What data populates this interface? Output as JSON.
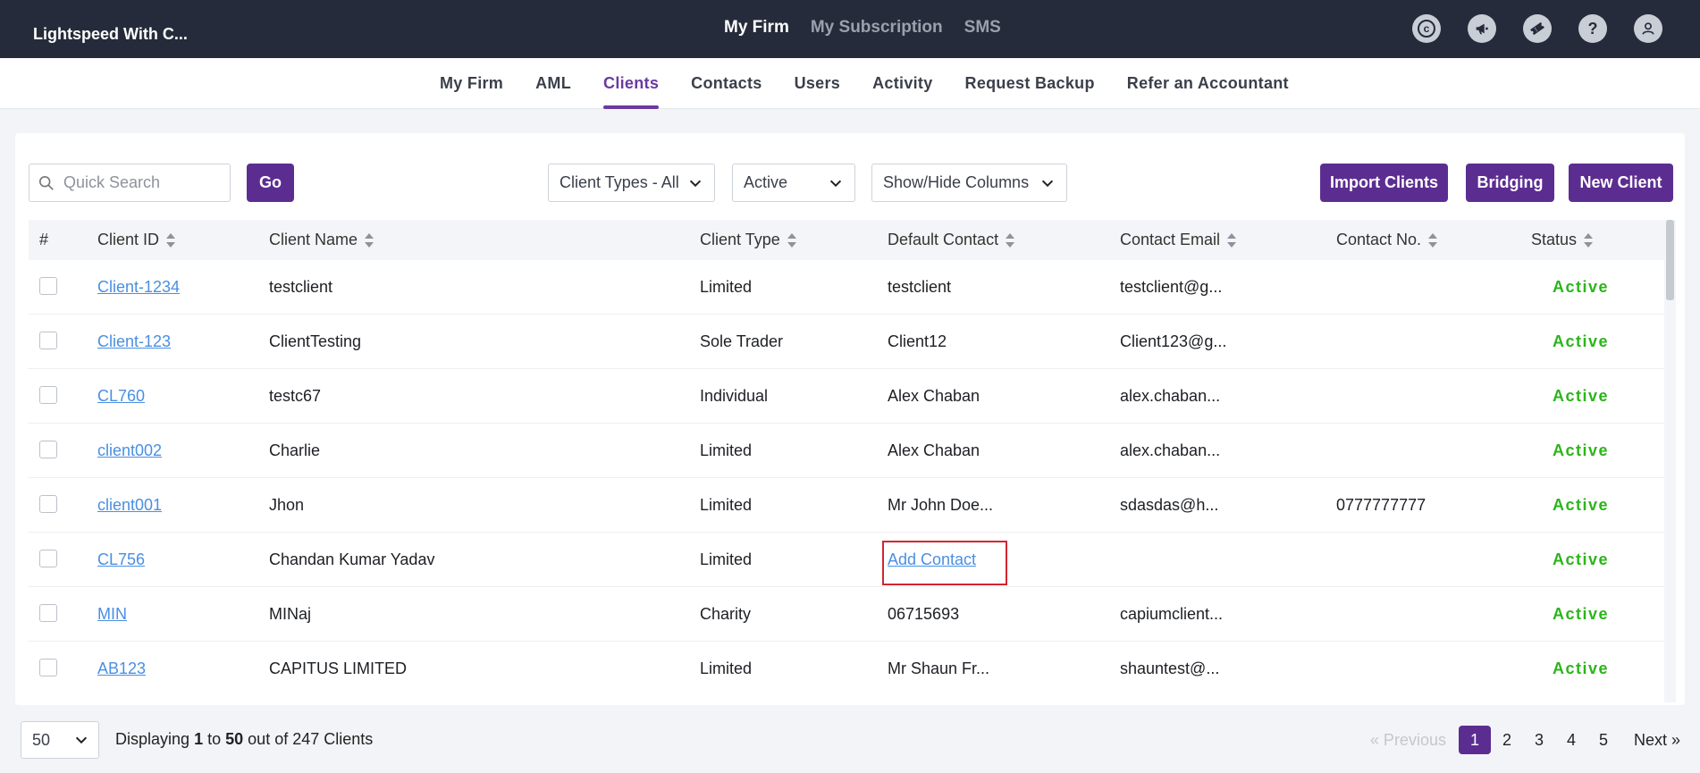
{
  "brand": "Lightspeed With C...",
  "top_nav": [
    {
      "label": "My Firm",
      "active": true
    },
    {
      "label": "My Subscription",
      "active": false
    },
    {
      "label": "SMS",
      "active": false
    }
  ],
  "top_icons": [
    "capium-icon",
    "megaphone-icon",
    "ticket-icon",
    "help-icon",
    "user-icon"
  ],
  "top_icon_glyphs": {
    "capium": "c",
    "help": "?"
  },
  "sub_nav": [
    {
      "label": "My Firm",
      "active": false
    },
    {
      "label": "AML",
      "active": false
    },
    {
      "label": "Clients",
      "active": true
    },
    {
      "label": "Contacts",
      "active": false
    },
    {
      "label": "Users",
      "active": false
    },
    {
      "label": "Activity",
      "active": false
    },
    {
      "label": "Request Backup",
      "active": false
    },
    {
      "label": "Refer an Accountant",
      "active": false
    }
  ],
  "toolbar": {
    "search_placeholder": "Quick Search",
    "go_label": "Go",
    "client_types": "Client Types - All",
    "status_filter": "Active",
    "show_hide": "Show/Hide Columns",
    "import_label": "Import Clients",
    "bridging_label": "Bridging",
    "new_client_label": "New Client"
  },
  "columns": {
    "num": "#",
    "client_id": "Client ID",
    "client_name": "Client Name",
    "client_type": "Client Type",
    "default_contact": "Default Contact",
    "contact_email": "Contact Email",
    "contact_no": "Contact No.",
    "status": "Status"
  },
  "rows": [
    {
      "id": "Client-1234",
      "name": "testclient",
      "type": "Limited",
      "contact": "testclient",
      "email": "testclient@g...",
      "phone": "",
      "status": "Active"
    },
    {
      "id": "Client-123",
      "name": "ClientTesting",
      "type": "Sole Trader",
      "contact": "Client12",
      "email": "Client123@g...",
      "phone": "",
      "status": "Active"
    },
    {
      "id": "CL760",
      "name": "testc67",
      "type": "Individual",
      "contact": "Alex Chaban",
      "email": "alex.chaban...",
      "phone": "",
      "status": "Active"
    },
    {
      "id": "client002",
      "name": "Charlie",
      "type": "Limited",
      "contact": "Alex Chaban",
      "email": "alex.chaban...",
      "phone": "",
      "status": "Active"
    },
    {
      "id": "client001",
      "name": "Jhon",
      "type": "Limited",
      "contact": "Mr John Doe...",
      "email": "sdasdas@h...",
      "phone": "0777777777",
      "status": "Active"
    },
    {
      "id": "CL756",
      "name": "Chandan Kumar Yadav",
      "type": "Limited",
      "contact": "Add Contact",
      "email": "",
      "phone": "",
      "status": "Active",
      "add_contact": true
    },
    {
      "id": "MIN",
      "name": "MINaj",
      "type": "Charity",
      "contact": "06715693",
      "email": "capiumclient...",
      "phone": "",
      "status": "Active"
    },
    {
      "id": "AB123",
      "name": "CAPITUS LIMITED",
      "type": "Limited",
      "contact": "Mr Shaun Fr...",
      "email": "shauntest@...",
      "phone": "",
      "status": "Active"
    }
  ],
  "footer": {
    "per_page": "50",
    "displaying_prefix": "Displaying",
    "from": "1",
    "to_word": "to",
    "to": "50",
    "total_text": "out of 247 Clients",
    "prev_label": "« Previous",
    "pages": [
      "1",
      "2",
      "3",
      "4",
      "5"
    ],
    "current_page": "1",
    "next_label": "Next »"
  },
  "colors": {
    "brand_purple": "#5c2d91",
    "active_green": "#2bb51a",
    "link_blue": "#4a8fe2",
    "topbar": "#252b3a",
    "highlight_red": "#d22630"
  }
}
